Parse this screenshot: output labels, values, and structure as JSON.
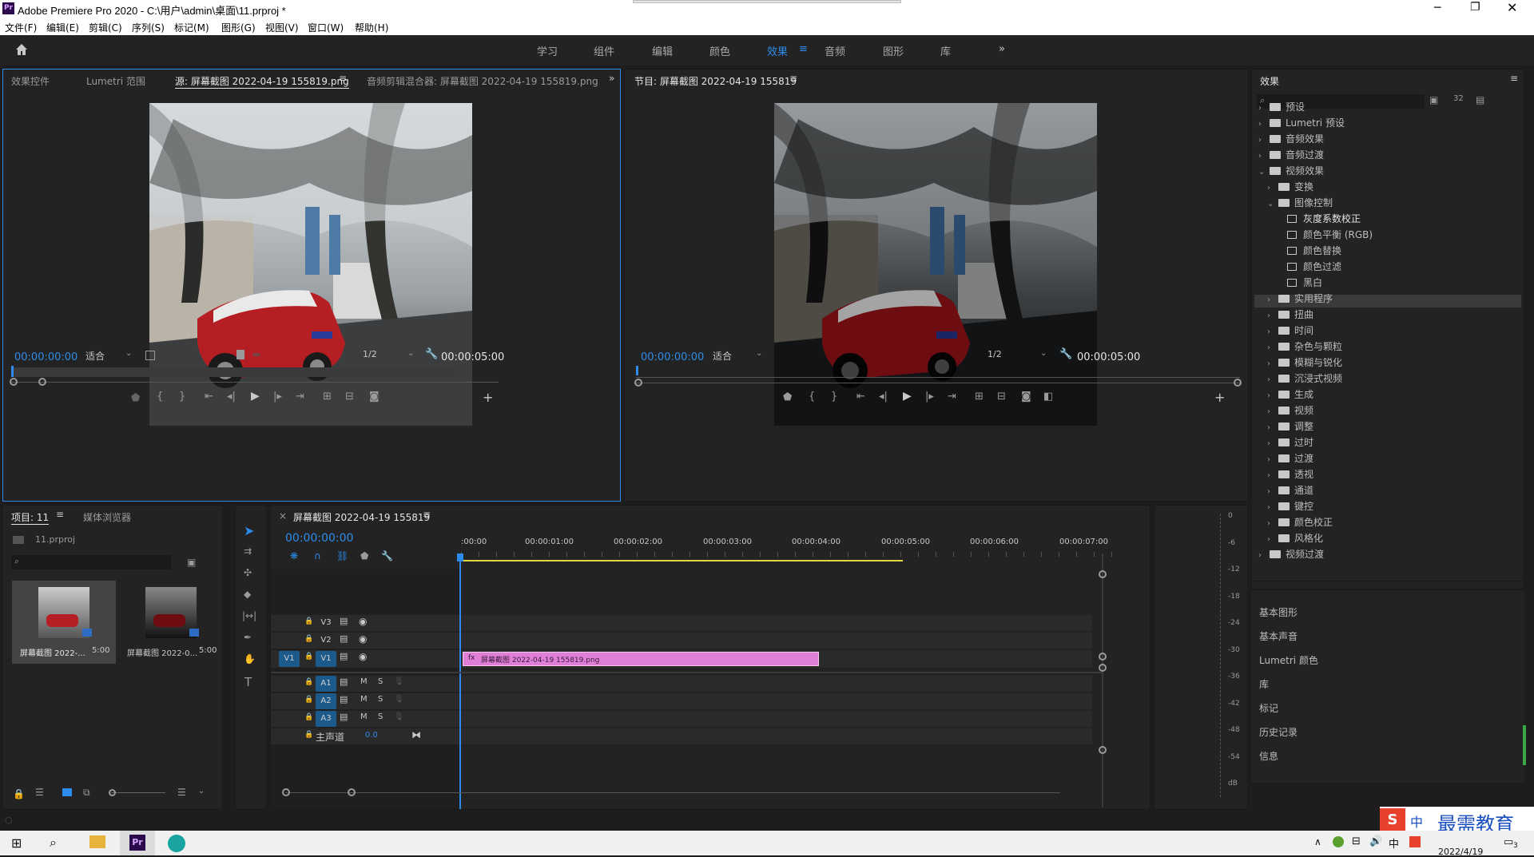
{
  "window": {
    "title": "Adobe Premiere Pro 2020 - C:\\用户\\admin\\桌面\\11.prproj *",
    "app_icon": "Pr"
  },
  "menu": [
    "文件(F)",
    "编辑(E)",
    "剪辑(C)",
    "序列(S)",
    "标记(M)",
    "图形(G)",
    "视图(V)",
    "窗口(W)",
    "帮助(H)"
  ],
  "workspaces": {
    "items": [
      "学习",
      "组件",
      "编辑",
      "颜色",
      "效果",
      "音频",
      "图形",
      "库"
    ],
    "active": "效果"
  },
  "source_panel": {
    "tabs": [
      "效果控件",
      "Lumetri 范围",
      "源: 屏幕截图 2022-04-19 155819.png",
      "音频剪辑混合器: 屏幕截图 2022-04-19 155819.png"
    ],
    "timecode": "00:00:00:00",
    "fit": "适合",
    "ratio": "1/2",
    "duration": "00:00:05:00"
  },
  "program_panel": {
    "tab": "节目: 屏幕截图 2022-04-19 155819",
    "timecode": "00:00:00:00",
    "fit": "适合",
    "ratio": "1/2",
    "duration": "00:00:05:00"
  },
  "project_panel": {
    "tabs": [
      "项目: 11",
      "媒体浏览器"
    ],
    "file": "11.prproj",
    "items": [
      {
        "label": "屏幕截图 2022-...",
        "dur": "5:00"
      },
      {
        "label": "屏幕截图 2022-0...",
        "dur": "5:00"
      }
    ]
  },
  "timeline": {
    "tab": "屏幕截图 2022-04-19 155819",
    "timecode": "00:00:00:00",
    "ruler": [
      ":00:00",
      "00:00:01:00",
      "00:00:02:00",
      "00:00:03:00",
      "00:00:04:00",
      "00:00:05:00",
      "00:00:06:00",
      "00:00:07:00"
    ],
    "video_tracks": [
      "V3",
      "V2",
      "V1"
    ],
    "audio_tracks": [
      "A1",
      "A2",
      "A3"
    ],
    "master": "主声道",
    "master_val": "0.0",
    "clip": "屏幕截图 2022-04-19 155819.png",
    "source_patch": "V1"
  },
  "meter": {
    "ticks": [
      "0",
      "-6",
      "-12",
      "-18",
      "-24",
      "-30",
      "-36",
      "-42",
      "-48",
      "-54",
      "dB"
    ]
  },
  "effects": {
    "title": "效果",
    "tree": [
      {
        "label": "预设",
        "level": 0,
        "type": "bin",
        "arrow": "›"
      },
      {
        "label": "Lumetri 预设",
        "level": 0,
        "type": "bin",
        "arrow": "›"
      },
      {
        "label": "音频效果",
        "level": 0,
        "type": "folder",
        "arrow": "›"
      },
      {
        "label": "音频过渡",
        "level": 0,
        "type": "folder",
        "arrow": "›"
      },
      {
        "label": "视频效果",
        "level": 0,
        "type": "folder",
        "arrow": "⌄"
      },
      {
        "label": "变换",
        "level": 1,
        "type": "folder",
        "arrow": "›"
      },
      {
        "label": "图像控制",
        "level": 1,
        "type": "folder",
        "arrow": "⌄"
      },
      {
        "label": "灰度系数校正",
        "level": 2,
        "type": "effect",
        "arrow": ""
      },
      {
        "label": "颜色平衡 (RGB)",
        "level": 2,
        "type": "effect",
        "arrow": ""
      },
      {
        "label": "颜色替换",
        "level": 2,
        "type": "effect",
        "arrow": ""
      },
      {
        "label": "颜色过滤",
        "level": 2,
        "type": "effect",
        "arrow": ""
      },
      {
        "label": "黑白",
        "level": 2,
        "type": "effect",
        "arrow": ""
      },
      {
        "label": "实用程序",
        "level": 1,
        "type": "folder",
        "arrow": "›"
      },
      {
        "label": "扭曲",
        "level": 1,
        "type": "folder",
        "arrow": "›"
      },
      {
        "label": "时间",
        "level": 1,
        "type": "folder",
        "arrow": "›"
      },
      {
        "label": "杂色与颗粒",
        "level": 1,
        "type": "folder",
        "arrow": "›"
      },
      {
        "label": "模糊与锐化",
        "level": 1,
        "type": "folder",
        "arrow": "›"
      },
      {
        "label": "沉浸式视频",
        "level": 1,
        "type": "folder",
        "arrow": "›"
      },
      {
        "label": "生成",
        "level": 1,
        "type": "folder",
        "arrow": "›"
      },
      {
        "label": "视频",
        "level": 1,
        "type": "folder",
        "arrow": "›"
      },
      {
        "label": "调整",
        "level": 1,
        "type": "folder",
        "arrow": "›"
      },
      {
        "label": "过时",
        "level": 1,
        "type": "folder",
        "arrow": "›"
      },
      {
        "label": "过渡",
        "level": 1,
        "type": "folder",
        "arrow": "›"
      },
      {
        "label": "透视",
        "level": 1,
        "type": "folder",
        "arrow": "›"
      },
      {
        "label": "通道",
        "level": 1,
        "type": "folder",
        "arrow": "›"
      },
      {
        "label": "键控",
        "level": 1,
        "type": "folder",
        "arrow": "›"
      },
      {
        "label": "颜色校正",
        "level": 1,
        "type": "folder",
        "arrow": "›"
      },
      {
        "label": "风格化",
        "level": 1,
        "type": "folder",
        "arrow": "›"
      },
      {
        "label": "视频过渡",
        "level": 0,
        "type": "folder",
        "arrow": "›"
      }
    ],
    "selected": "灰度系数校正",
    "collapsed_panels": [
      "基本图形",
      "基本声音",
      "Lumetri 颜色",
      "库",
      "标记",
      "历史记录",
      "信息"
    ]
  },
  "watermark": {
    "brand": "中",
    "text": "最需教育"
  },
  "taskbar": {
    "date": "2022/4/19",
    "ime": "中",
    "notif": "3"
  }
}
